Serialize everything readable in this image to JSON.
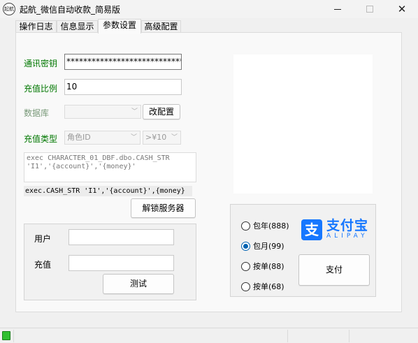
{
  "window": {
    "title": "起航_微信自动收款_简易版",
    "icon_text": "起航"
  },
  "tabs": [
    {
      "label": "操作日志"
    },
    {
      "label": "信息显示"
    },
    {
      "label": "参数设置",
      "active": true
    },
    {
      "label": "高级配置"
    }
  ],
  "settings": {
    "secret_label": "通讯密钥",
    "secret_value": "******************************",
    "ratio_label": "充值比例",
    "ratio_value": "10",
    "db_label": "数据库",
    "db_value": "",
    "db_button": "改配置",
    "type_label": "充值类型",
    "type_value": "角色ID",
    "amount_value": ">¥10",
    "sql_template": "exec CHARACTER_01_DBF.dbo.CASH_STR\n'I1','{account}','{money}'",
    "sql_preview": "exec.CASH_STR 'I1','{account}',{money}",
    "unlock_button": "解锁服务器"
  },
  "test": {
    "user_label": "用户",
    "user_value": "",
    "amount_label": "充值",
    "amount_value": "",
    "test_button": "测试"
  },
  "payment": {
    "options": [
      {
        "label": "包年(888)",
        "checked": false
      },
      {
        "label": "包月(99)",
        "checked": true
      },
      {
        "label": "按单(88)",
        "checked": false
      },
      {
        "label": "按单(68)",
        "checked": false
      }
    ],
    "logo_cn": "支付宝",
    "logo_en": "ALIPAY",
    "logo_mark": "支",
    "pay_button": "支付",
    "brand_color": "#1677ff"
  },
  "colors": {
    "label_green": "#007700",
    "radio_blue": "#0063b1",
    "status_green": "#2fbf2f"
  }
}
